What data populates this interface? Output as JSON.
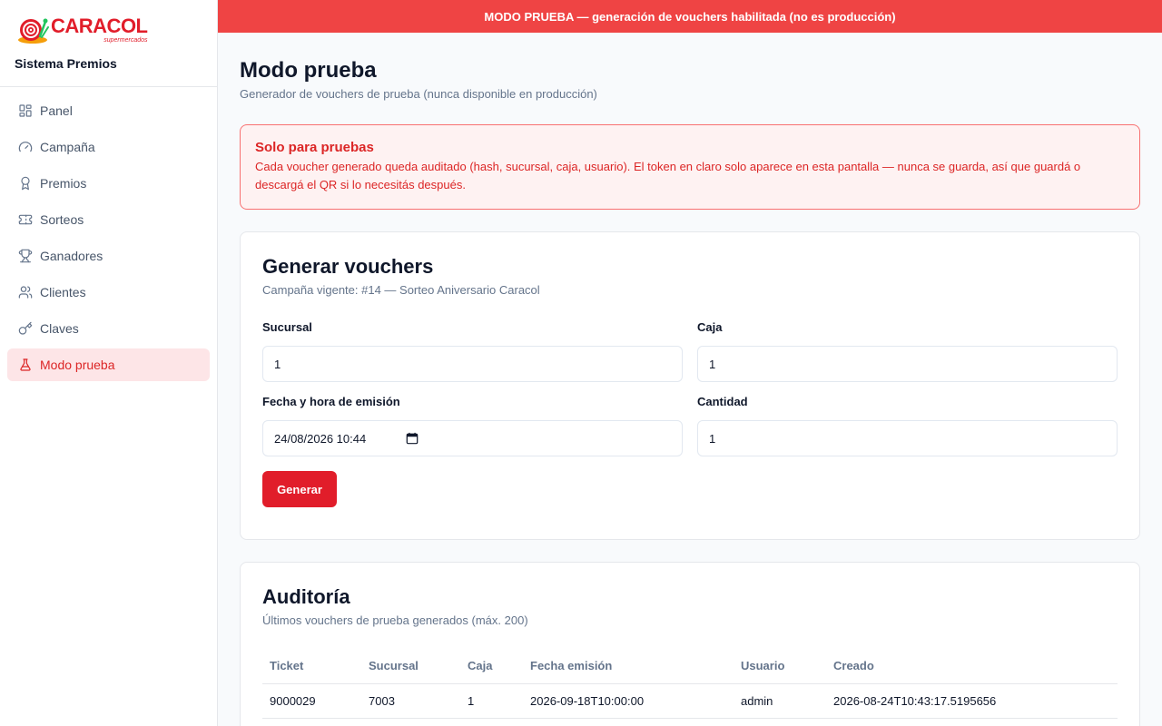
{
  "brand": {
    "logo_word": "CARACOL",
    "logo_sub": "supermercados",
    "app_name": "Sistema Premios"
  },
  "sidebar": {
    "items": [
      {
        "label": "Panel",
        "icon": "dashboard-icon"
      },
      {
        "label": "Campaña",
        "icon": "gauge-icon"
      },
      {
        "label": "Premios",
        "icon": "award-icon"
      },
      {
        "label": "Sorteos",
        "icon": "ticket-icon"
      },
      {
        "label": "Ganadores",
        "icon": "trophy-icon"
      },
      {
        "label": "Clientes",
        "icon": "users-icon"
      },
      {
        "label": "Claves",
        "icon": "key-icon"
      },
      {
        "label": "Modo prueba",
        "icon": "flask-icon",
        "active": true
      }
    ]
  },
  "banner": {
    "text": "MODO PRUEBA — generación de vouchers habilitada (no es producción)"
  },
  "page": {
    "title": "Modo prueba",
    "subtitle": "Generador de vouchers de prueba (nunca disponible en producción)"
  },
  "alert": {
    "title": "Solo para pruebas",
    "body": "Cada voucher generado queda auditado (hash, sucursal, caja, usuario). El token en claro solo aparece en esta pantalla — nunca se guarda, así que guardá o descargá el QR si lo necesitás después."
  },
  "generator": {
    "title": "Generar vouchers",
    "subtitle": "Campaña vigente: #14 — Sorteo Aniversario Caracol",
    "fields": {
      "sucursal": {
        "label": "Sucursal",
        "value": "1"
      },
      "caja": {
        "label": "Caja",
        "value": "1"
      },
      "fecha": {
        "label": "Fecha y hora de emisión",
        "value": "24/08/2026 10:44"
      },
      "cantidad": {
        "label": "Cantidad",
        "value": "1"
      }
    },
    "button_label": "Generar"
  },
  "audit": {
    "title": "Auditoría",
    "subtitle": "Últimos vouchers de prueba generados (máx. 200)",
    "columns": [
      "Ticket",
      "Sucursal",
      "Caja",
      "Fecha emisión",
      "Usuario",
      "Creado"
    ],
    "rows": [
      [
        "9000029",
        "7003",
        "1",
        "2026-09-18T10:00:00",
        "admin",
        "2026-08-24T10:43:17.5195656"
      ]
    ]
  },
  "colors": {
    "accent": "#e11d2a",
    "banner": "#ef4444",
    "active_nav_bg": "#fde5e7",
    "alert_border": "#f87171"
  }
}
